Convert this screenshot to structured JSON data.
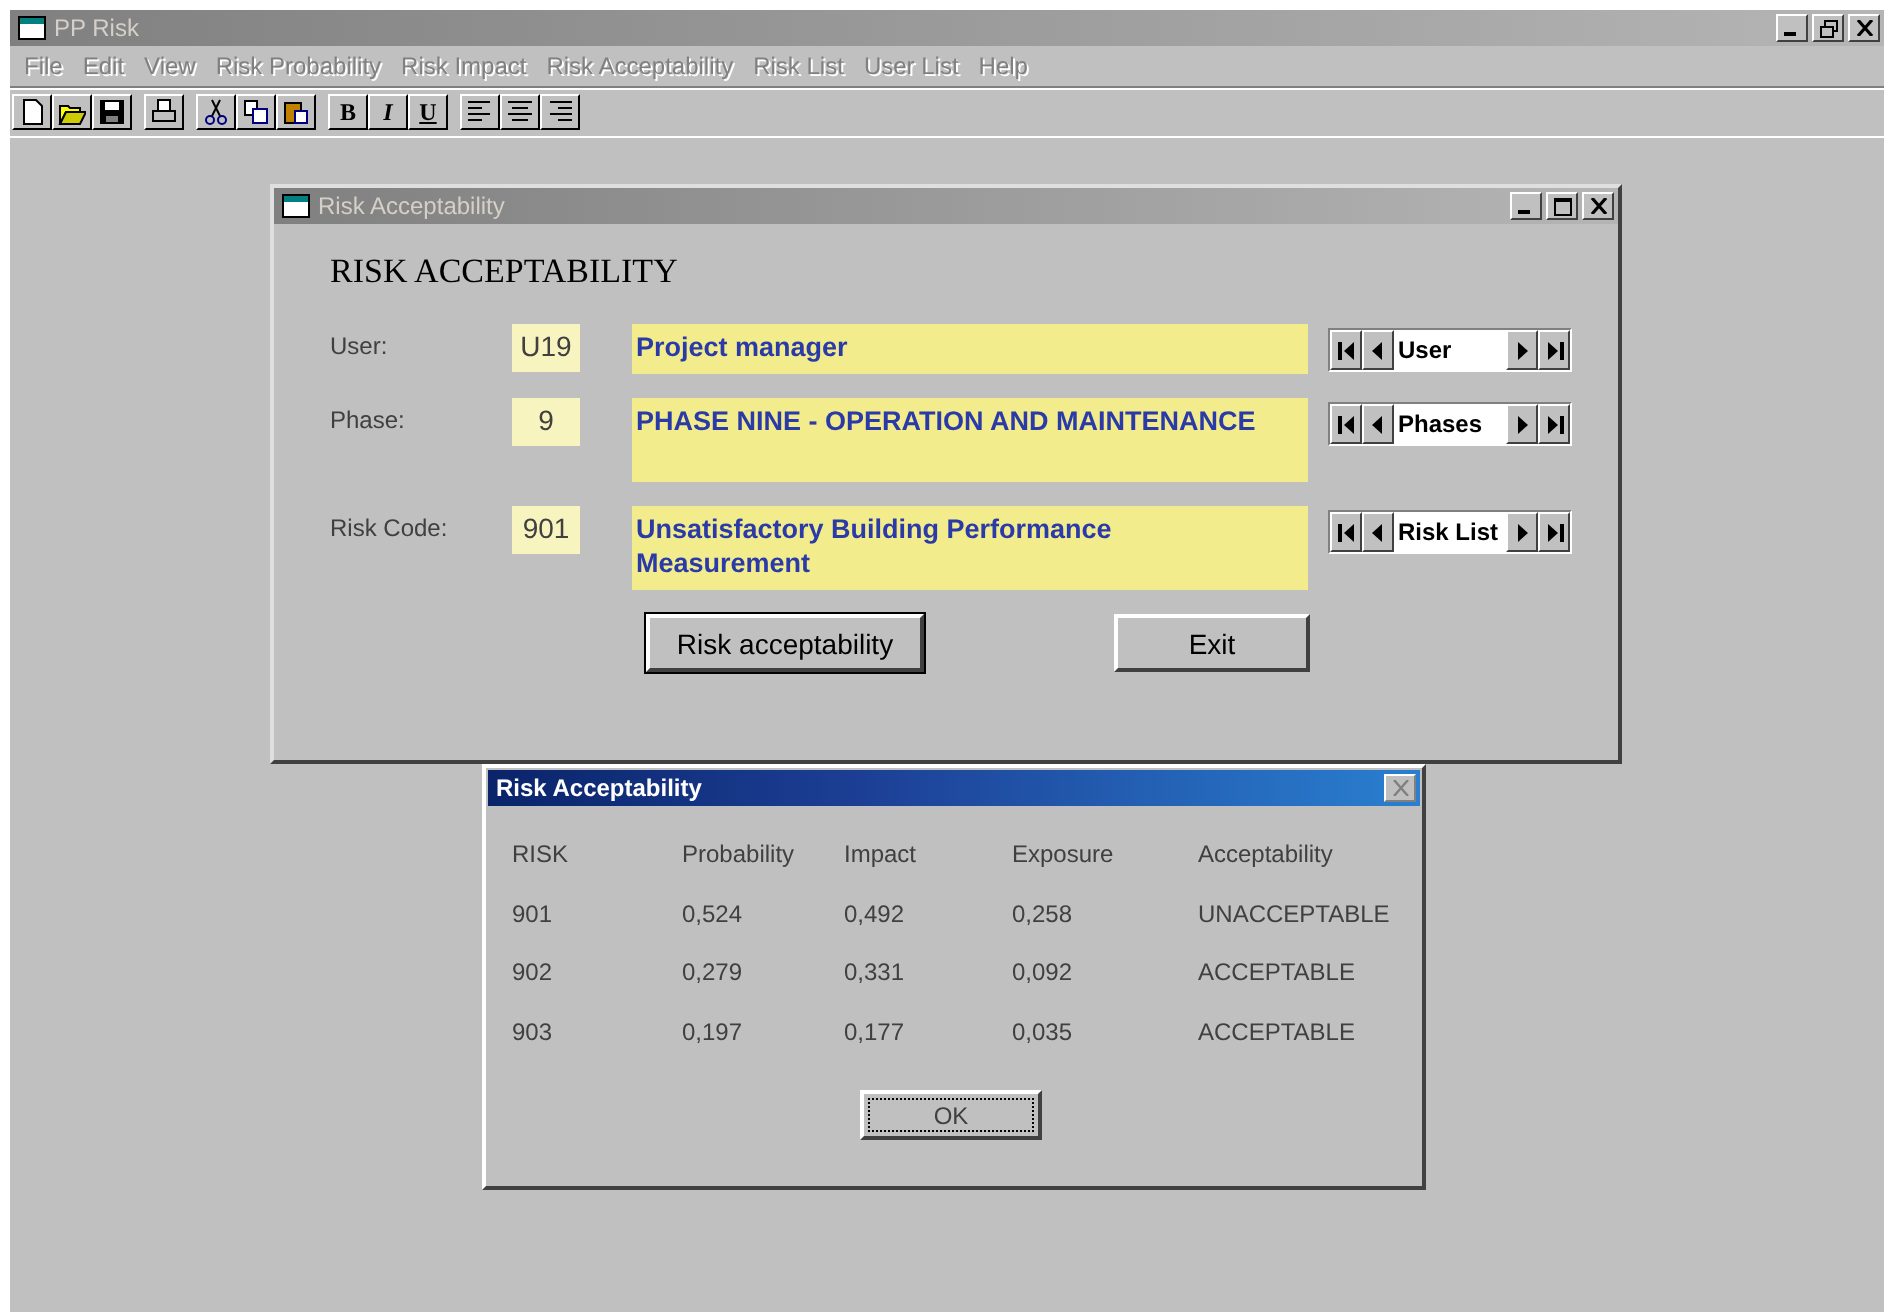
{
  "window": {
    "title": "PP Risk",
    "active": false
  },
  "menu": [
    {
      "label": "File",
      "disabled": true
    },
    {
      "label": "Edit",
      "disabled": true
    },
    {
      "label": "View",
      "disabled": true
    },
    {
      "label": "Risk Probability",
      "disabled": true
    },
    {
      "label": "Risk Impact",
      "disabled": true
    },
    {
      "label": "Risk Acceptability",
      "disabled": true
    },
    {
      "label": "Risk List",
      "disabled": true
    },
    {
      "label": "User List",
      "disabled": true
    },
    {
      "label": "Help",
      "disabled": true
    }
  ],
  "toolbar": [
    [
      {
        "kind": "new"
      },
      {
        "kind": "open"
      },
      {
        "kind": "save"
      }
    ],
    [
      {
        "kind": "print"
      }
    ],
    [
      {
        "kind": "cut"
      },
      {
        "kind": "copy"
      },
      {
        "kind": "paste"
      }
    ],
    [
      {
        "kind": "bold",
        "label": "B"
      },
      {
        "kind": "italic",
        "label": "I"
      },
      {
        "kind": "underline",
        "label": "U"
      }
    ],
    [
      {
        "kind": "align-left"
      },
      {
        "kind": "align-center"
      },
      {
        "kind": "align-right"
      }
    ]
  ],
  "form_window": {
    "title": "Risk Acceptability",
    "active": false,
    "heading": "RISK ACCEPTABILITY",
    "fields": [
      {
        "label": "User:",
        "code": "U19",
        "description": "Project manager",
        "kind": "short",
        "navigator": "User"
      },
      {
        "label": "Phase:",
        "code": "9",
        "description": "PHASE NINE - OPERATION AND MAINTENANCE",
        "kind": "tall",
        "navigator": "Phases"
      },
      {
        "label": "Risk Code:",
        "code": "901",
        "description": "Unsatisfactory Building Performance Measurement",
        "kind": "tall",
        "navigator": "Risk List"
      }
    ],
    "buttons": [
      {
        "label": "Risk acceptability",
        "default": true
      },
      {
        "label": "Exit",
        "default": false
      }
    ]
  },
  "dialog": {
    "title": "Risk Acceptability",
    "active": true,
    "columns": [
      "RISK",
      "Probability",
      "Impact",
      "Exposure",
      "Acceptability"
    ],
    "rows": [
      [
        "901",
        "0,524",
        "0,492",
        "0,258",
        "UNACCEPTABLE"
      ],
      [
        "902",
        "0,279",
        "0,331",
        "0,092",
        "ACCEPTABLE"
      ],
      [
        "903",
        "0,197",
        "0,177",
        "0,035",
        "ACCEPTABLE"
      ]
    ],
    "button": "OK"
  }
}
